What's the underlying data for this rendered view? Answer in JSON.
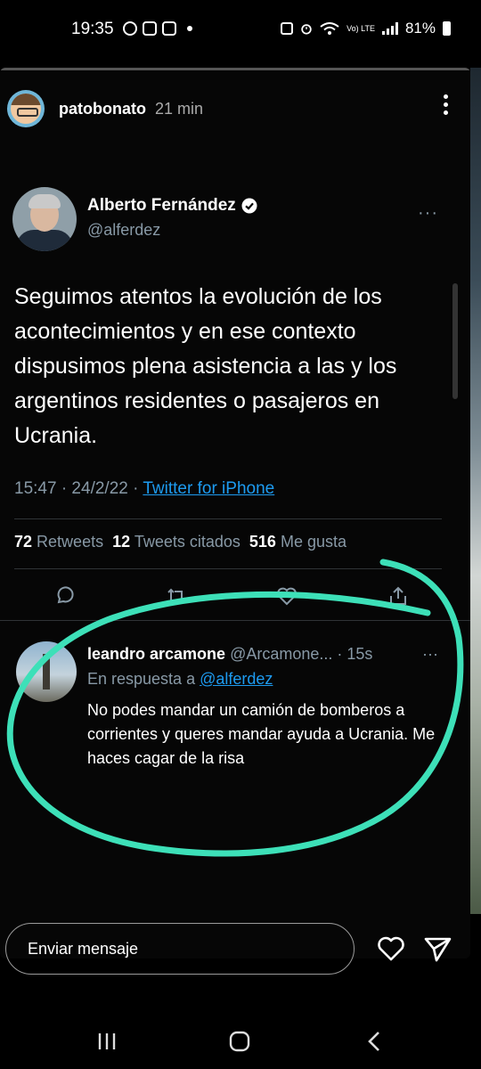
{
  "status_bar": {
    "time": "19:35",
    "battery": "81%",
    "network": "Vo) LTE",
    "icons": [
      "messenger-icon",
      "app-icon",
      "instagram-icon",
      "notification-dot",
      "alarm-icon",
      "wifi-icon",
      "signal-icon",
      "battery-icon"
    ]
  },
  "story": {
    "username": "patobonato",
    "time_ago": "21 min"
  },
  "tweet": {
    "author_name": "Alberto Fernández",
    "author_handle": "@alferdez",
    "more": "···",
    "text": "Seguimos atentos la evolución de los acontecimientos y en ese contexto dispusimos plena asistencia a las y los argentinos residentes o pasajeros en Ucrania.",
    "time": "15:47 · 24/2/22 · ",
    "source": "Twitter for iPhone",
    "retweets_count": "72",
    "retweets_label": "Retweets",
    "quotes_count": "12",
    "quotes_label": "Tweets citados",
    "likes_count": "516",
    "likes_label": "Me gusta"
  },
  "reply": {
    "name": "leandro arcamone",
    "handle": "@Arcamone...",
    "time": "15s",
    "more": "···",
    "in_reply_prefix": "En respuesta a ",
    "in_reply_mention": "@alferdez",
    "text": "No podes mandar un camión de bomberos a corrientes y queres mandar ayuda a Ucrania. Me haces cagar de la risa"
  },
  "message_bar": {
    "placeholder": "Enviar mensaje"
  },
  "colors": {
    "annotation": "#3de0b8",
    "link": "#1d9bf0",
    "muted": "#8899a6"
  }
}
